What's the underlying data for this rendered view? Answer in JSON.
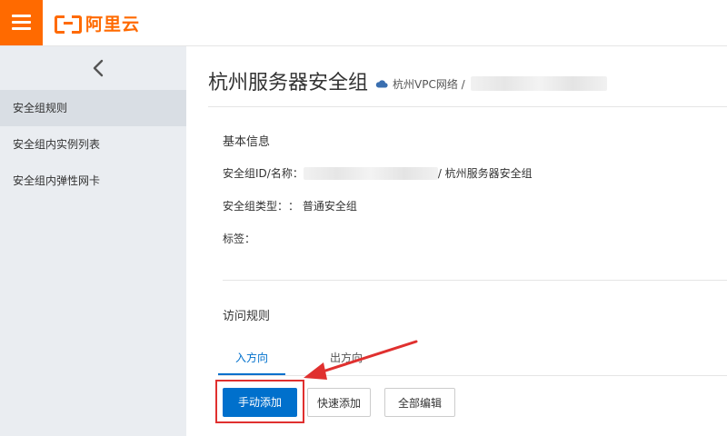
{
  "header": {
    "logo_text": "阿里云",
    "menu_icon": "hamburger-icon"
  },
  "sidebar": {
    "back_icon": "chevron-left-icon",
    "items": [
      {
        "label": "安全组规则",
        "active": true
      },
      {
        "label": "安全组内实例列表",
        "active": false
      },
      {
        "label": "安全组内弹性网卡",
        "active": false
      }
    ]
  },
  "main": {
    "title": "杭州服务器安全组",
    "crumb": {
      "icon": "cloud-icon",
      "network": "杭州VPC网络 /"
    },
    "basic_info": {
      "title": "基本信息",
      "id_label": "安全组ID/名称：",
      "id_value_suffix": "/ 杭州服务器安全组",
      "type_label": "安全组类型：",
      "type_value": "：  普通安全组",
      "tags_label": "标签："
    },
    "access_rules": {
      "title": "访问规则",
      "tabs": [
        {
          "label": "入方向",
          "active": true
        },
        {
          "label": "出方向",
          "active": false
        }
      ],
      "buttons": {
        "manual_add": "手动添加",
        "quick_add": "快速添加",
        "edit_all": "全部编辑"
      }
    }
  },
  "colors": {
    "brand": "#ff6a00",
    "primary": "#0070cc",
    "annotation": "#e0302f"
  }
}
